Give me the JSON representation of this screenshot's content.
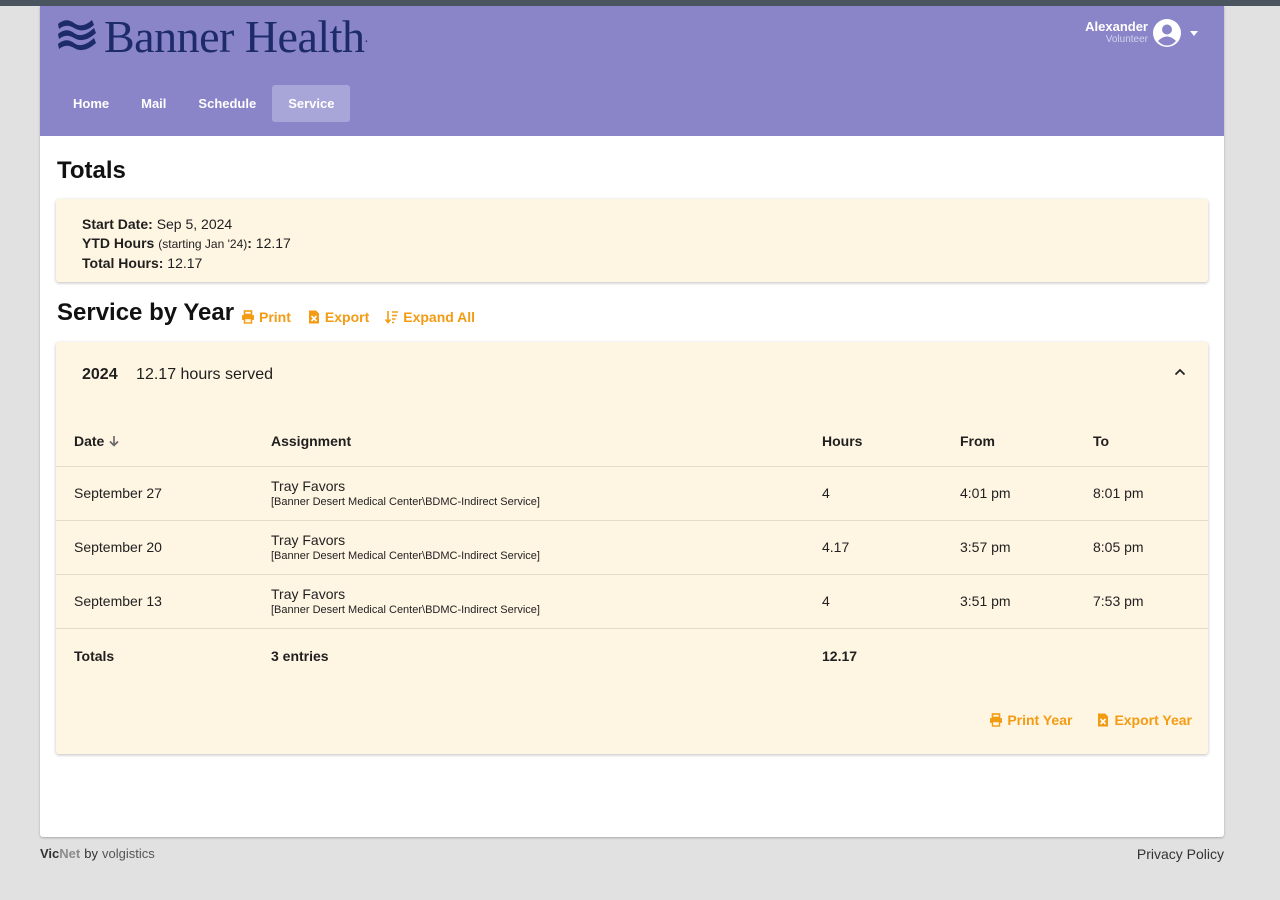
{
  "header": {
    "brand": "Banner Health",
    "brand_suffix": ".",
    "user": {
      "name": "Alexander",
      "role": "Volunteer"
    },
    "nav": [
      {
        "label": "Home"
      },
      {
        "label": "Mail"
      },
      {
        "label": "Schedule"
      },
      {
        "label": "Service",
        "active": true
      }
    ],
    "colors": {
      "header_bg": "#8985c8",
      "brand_text": "#1d2b6b",
      "accent": "#f39b12"
    }
  },
  "totals": {
    "heading": "Totals",
    "start_date_label": "Start Date:",
    "start_date": "Sep 5, 2024",
    "ytd_label": "YTD Hours",
    "ytd_note": "(starting Jan '24)",
    "ytd_colon": ":",
    "ytd_value": "12.17",
    "total_label": "Total Hours:",
    "total_value": "12.17"
  },
  "service": {
    "heading": "Service by Year",
    "print_label": "Print",
    "export_label": "Export",
    "expand_label": "Expand All"
  },
  "year": {
    "year": "2024",
    "summary": "12.17 hours served",
    "columns": {
      "date": "Date",
      "assignment": "Assignment",
      "hours": "Hours",
      "from": "From",
      "to": "To"
    },
    "rows": [
      {
        "date": "September 27",
        "assignment": "Tray Favors",
        "location": "[Banner Desert Medical Center\\BDMC-Indirect Service]",
        "hours": "4",
        "from": "4:01 pm",
        "to": "8:01 pm"
      },
      {
        "date": "September 20",
        "assignment": "Tray Favors",
        "location": "[Banner Desert Medical Center\\BDMC-Indirect Service]",
        "hours": "4.17",
        "from": "3:57 pm",
        "to": "8:05 pm"
      },
      {
        "date": "September 13",
        "assignment": "Tray Favors",
        "location": "[Banner Desert Medical Center\\BDMC-Indirect Service]",
        "hours": "4",
        "from": "3:51 pm",
        "to": "7:53 pm"
      }
    ],
    "totals_row": {
      "label": "Totals",
      "entries": "3 entries",
      "hours": "12.17"
    },
    "print_year_label": "Print Year",
    "export_year_label": "Export Year"
  },
  "footer": {
    "vic": "Vic",
    "net": "Net",
    "by": "by",
    "volgistics": "volgistics",
    "privacy": "Privacy Policy"
  }
}
